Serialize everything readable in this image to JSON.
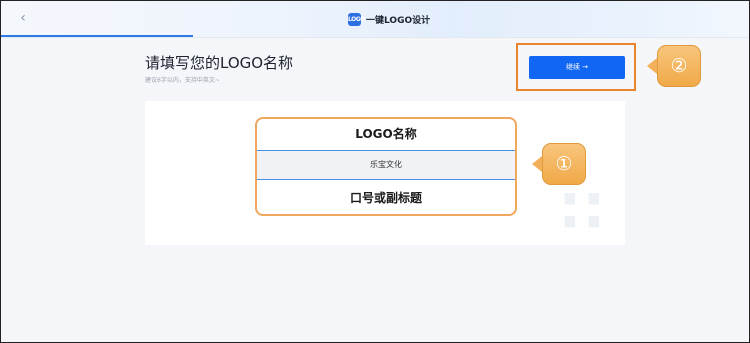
{
  "header": {
    "back_icon": "chevron-left-icon",
    "brand_logo_text": "LOGO",
    "title": "一键LOGO设计"
  },
  "page": {
    "title": "请填写您的LOGO名称",
    "subtitle": "建议6字以内，支持中英文~"
  },
  "actions": {
    "continue_label": "继续 →"
  },
  "form": {
    "name_heading": "LOGO名称",
    "name_value": "乐宝文化",
    "slogan_heading": "口号或副标题"
  },
  "callouts": {
    "one": "①",
    "two": "②"
  },
  "colors": {
    "primary": "#1166f4",
    "callout": "#f0a948",
    "highlight_border": "#e8842c"
  }
}
